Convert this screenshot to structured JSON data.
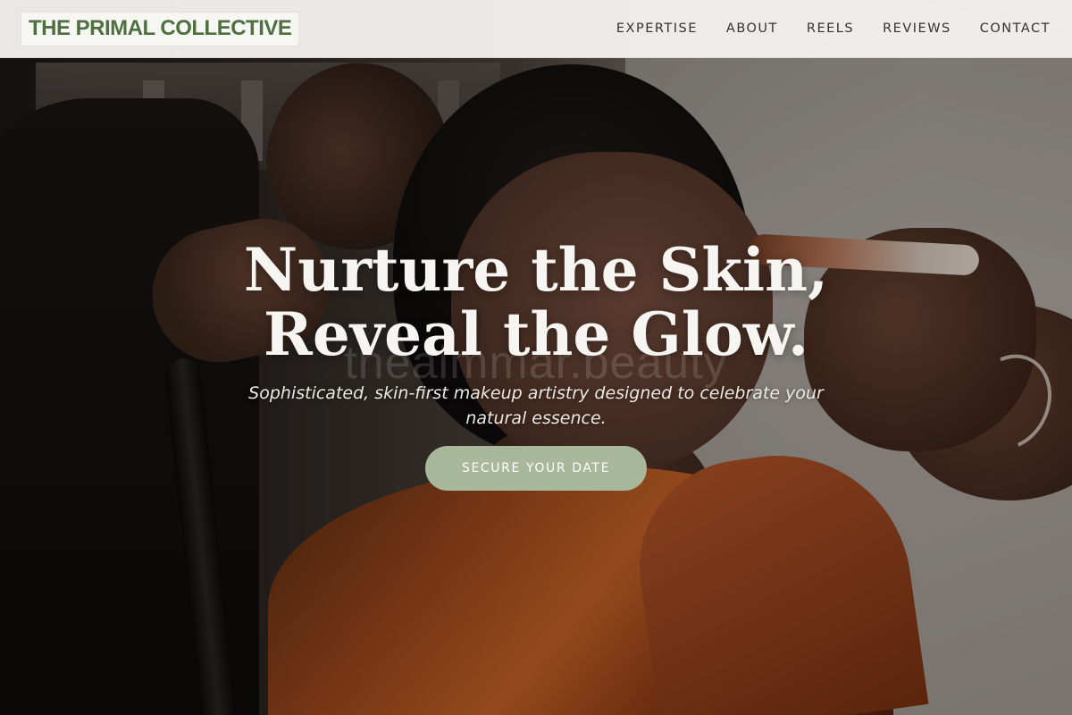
{
  "brand": {
    "logo_text": "THE PRIMAL COLLECTIVE"
  },
  "nav": {
    "items": [
      {
        "label": "EXPERTISE"
      },
      {
        "label": "ABOUT"
      },
      {
        "label": "REELS"
      },
      {
        "label": "REVIEWS"
      },
      {
        "label": "CONTACT"
      }
    ]
  },
  "hero": {
    "headline_line1": "Nurture the Skin,",
    "headline_line2": "Reveal the Glow.",
    "watermark": "thealmmar.beauty",
    "subtitle": "Sophisticated, skin-first makeup artistry designed to celebrate your natural essence.",
    "cta_label": "SECURE YOUR DATE"
  },
  "colors": {
    "brand_green": "#4e7040",
    "cta_sage": "#a9b79a",
    "header_bg": "#f2f1ee"
  }
}
